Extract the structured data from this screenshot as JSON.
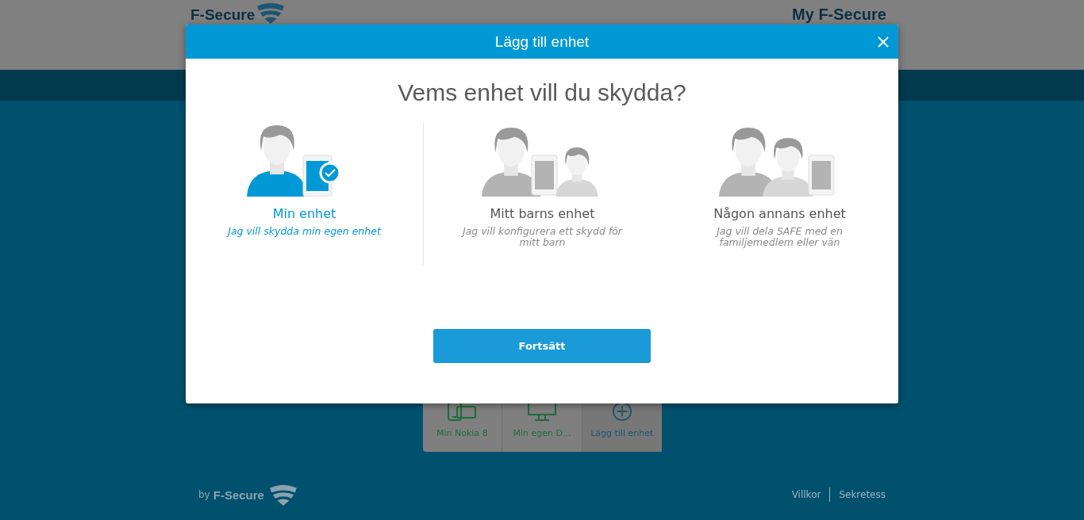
{
  "background": {
    "header": {
      "logo": "F-Secure",
      "app_title": "My F-Secure"
    },
    "devices": [
      {
        "kind": "phone",
        "label": "Min Nokia 8"
      },
      {
        "kind": "desktop",
        "label": "Min egen D..."
      },
      {
        "kind": "add",
        "label": "Lägg till enhet"
      }
    ],
    "footer": {
      "by": "by",
      "brand": "F-Secure",
      "links": [
        "Villkor",
        "Sekretess"
      ]
    }
  },
  "dialog": {
    "title": "Lägg till enhet",
    "heading": "Vems enhet vill du skydda?",
    "options": [
      {
        "kind": "self",
        "label": "Min enhet",
        "description": "Jag vill skydda min egen enhet",
        "selected": true
      },
      {
        "kind": "child",
        "label": "Mitt barns enhet",
        "description": "Jag vill konfigurera ett skydd för mitt barn",
        "selected": false
      },
      {
        "kind": "other",
        "label": "Någon annans enhet",
        "description": "Jag vill dela SAFE med en familjemedlem eller vän",
        "selected": false
      }
    ],
    "button": "Fortsätt"
  }
}
